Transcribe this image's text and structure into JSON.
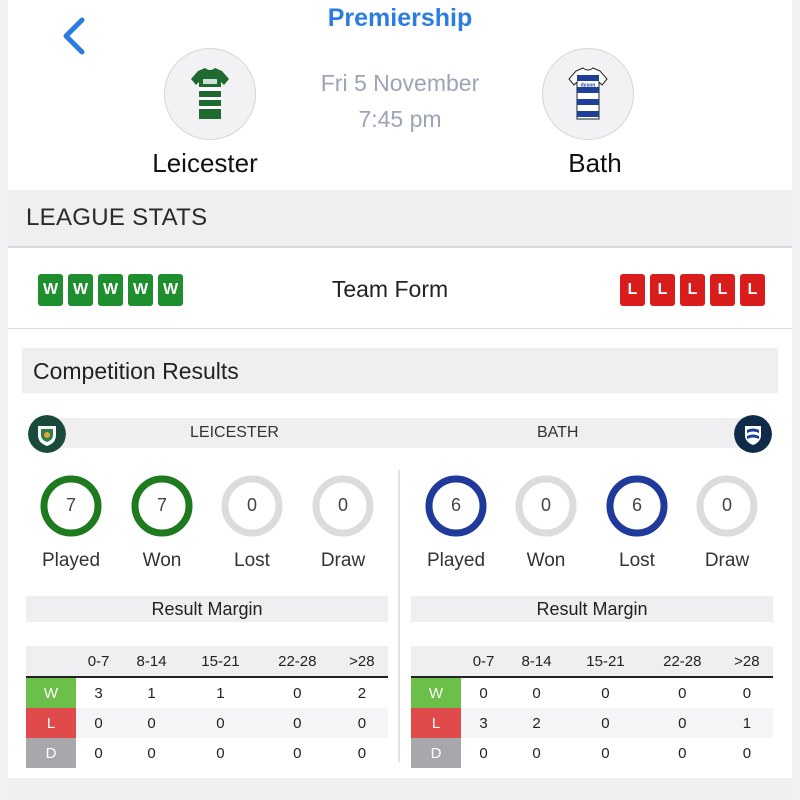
{
  "header": {
    "competition": "Premiership",
    "date": "Fri 5 November",
    "time": "7:45 pm"
  },
  "home_team": {
    "name": "Leicester",
    "bar_name": "LEICESTER",
    "form": [
      "W",
      "W",
      "W",
      "W",
      "W"
    ]
  },
  "away_team": {
    "name": "Bath",
    "bar_name": "BATH",
    "form": [
      "L",
      "L",
      "L",
      "L",
      "L"
    ],
    "sponsor": "dyson"
  },
  "league_stats": {
    "title": "LEAGUE STATS",
    "form_label": "Team Form"
  },
  "competition_results": {
    "title": "Competition Results",
    "stat_labels": [
      "Played",
      "Won",
      "Lost",
      "Draw"
    ],
    "home_stats": [
      7,
      7,
      0,
      0
    ],
    "away_stats": [
      6,
      0,
      6,
      0
    ],
    "result_margin_title": "Result Margin",
    "margin_columns": [
      "0-7",
      "8-14",
      "15-21",
      "22-28",
      ">28"
    ],
    "row_labels": [
      "W",
      "L",
      "D"
    ],
    "home_margins": {
      "W": [
        3,
        1,
        1,
        0,
        2
      ],
      "L": [
        0,
        0,
        0,
        0,
        0
      ],
      "D": [
        0,
        0,
        0,
        0,
        0
      ]
    },
    "away_margins": {
      "W": [
        0,
        0,
        0,
        0,
        0
      ],
      "L": [
        3,
        2,
        0,
        0,
        1
      ],
      "D": [
        0,
        0,
        0,
        0,
        0
      ]
    }
  },
  "colors": {
    "accent": "#2b7de1",
    "win": "#1e8e2e",
    "loss": "#d91c1c",
    "home_ring": "#1e7a1e",
    "away_ring": "#1f3a9a",
    "empty_ring": "#dcdcdc",
    "margin_w": "#6cc04a",
    "margin_l": "#e04a4a",
    "margin_d": "#a8a8ac"
  },
  "icons": {
    "back": "chevron-left-icon",
    "home_crest": "leicester-crest-icon",
    "away_crest": "bath-crest-icon"
  }
}
